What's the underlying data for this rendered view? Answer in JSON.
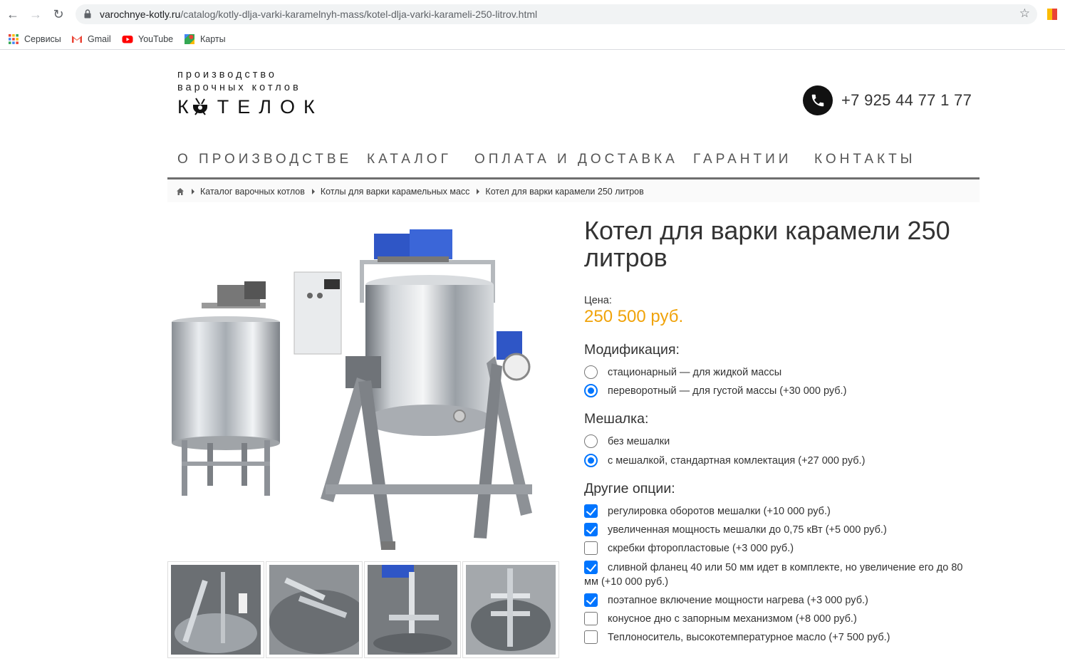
{
  "browser": {
    "url_host": "varochnye-kotly.ru",
    "url_path": "/catalog/kotly-dlja-varki-karamelnyh-mass/kotel-dlja-varki-karameli-250-litrov.html"
  },
  "bookmarks": [
    {
      "label": "Сервисы",
      "icon": "apps-grid-icon"
    },
    {
      "label": "Gmail",
      "icon": "gmail-icon"
    },
    {
      "label": "YouTube",
      "icon": "youtube-icon"
    },
    {
      "label": "Карты",
      "icon": "maps-icon"
    }
  ],
  "logo": {
    "line1": "производство",
    "line2": "варочных котлов",
    "brand": "ТЕЛОК",
    "brand_prefix": "К"
  },
  "header": {
    "phone": "+7 925 44 77 1 77"
  },
  "nav": [
    "О ПРОИЗВОДСТВЕ",
    "КАТАЛОГ",
    "ОПЛАТА И ДОСТАВКА",
    "ГАРАНТИИ",
    "КОНТАКТЫ"
  ],
  "breadcrumbs": [
    "Каталог варочных котлов",
    "Котлы для варки карамельных масс",
    "Котел для варки карамели 250 литров"
  ],
  "product": {
    "title": "Котел для варки карамели 250 литров",
    "price_label": "Цена:",
    "price": "250 500 руб.",
    "modification": {
      "title": "Модификация:",
      "options": [
        {
          "label": "стационарный — для жидкой массы",
          "checked": false
        },
        {
          "label": "переворотный — для густой массы (+30 000 руб.)",
          "checked": true
        }
      ]
    },
    "mixer": {
      "title": "Мешалка:",
      "options": [
        {
          "label": "без мешалки",
          "checked": false
        },
        {
          "label": "с мешалкой, стандартная комлектация (+27 000 руб.)",
          "checked": true
        }
      ]
    },
    "other": {
      "title": "Другие опции:",
      "options": [
        {
          "label": "регулировка оборотов мешалки (+10 000 руб.)",
          "checked": true
        },
        {
          "label": "увеличенная мощность мешалки до 0,75 кВт (+5 000 руб.)",
          "checked": true
        },
        {
          "label": "скребки фторопластовые (+3 000 руб.)",
          "checked": false
        },
        {
          "label": "сливной фланец 40 или 50 мм идет в комплекте, но увеличение его до 80 мм (+10 000 руб.)",
          "checked": true
        },
        {
          "label": "поэтапное включение мощности нагрева (+3 000 руб.)",
          "checked": true
        },
        {
          "label": "конусное дно с запорным механизмом (+8 000 руб.)",
          "checked": false
        },
        {
          "label": "Теплоноситель, высокотемпературное масло (+7 500 руб.)",
          "checked": false
        }
      ]
    }
  },
  "colors": {
    "price": "#f0a30a",
    "accent": "#0075ff",
    "nav_border": "#6e6e6e"
  }
}
